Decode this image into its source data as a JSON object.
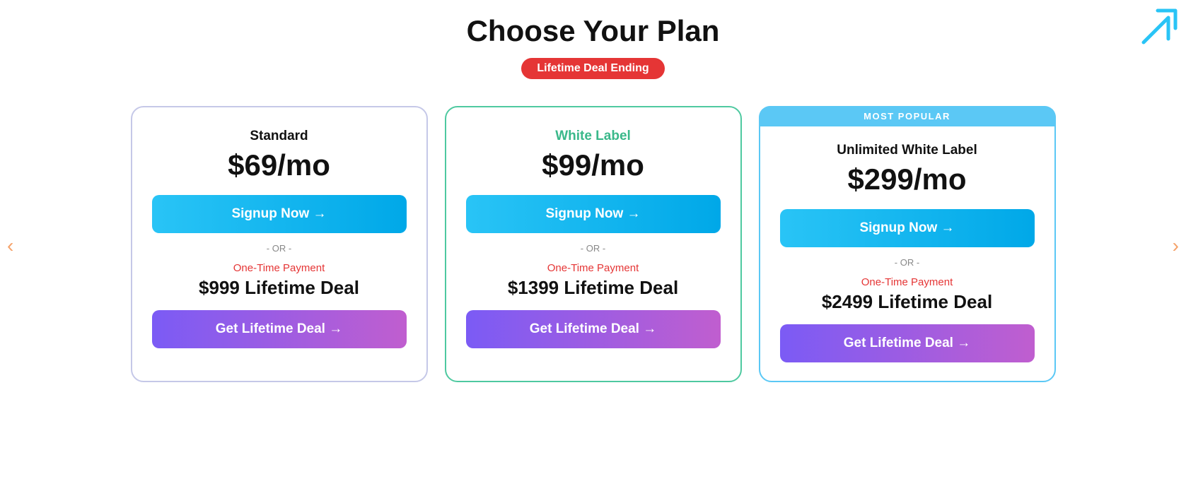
{
  "page": {
    "title": "Choose Your Plan",
    "badge": "Lifetime Deal Ending"
  },
  "nav": {
    "left_arrow": "‹",
    "right_arrow": "›"
  },
  "plans": [
    {
      "id": "standard",
      "name": "Standard",
      "name_color": "default",
      "price": "$69/mo",
      "most_popular": false,
      "signup_label": "Signup Now →",
      "or_text": "- OR -",
      "one_time_label": "One-Time Payment",
      "lifetime_price": "$999 Lifetime Deal",
      "lifetime_label": "Get Lifetime Deal →"
    },
    {
      "id": "white-label",
      "name": "White Label",
      "name_color": "green",
      "price": "$99/mo",
      "most_popular": false,
      "signup_label": "Signup Now →",
      "or_text": "- OR -",
      "one_time_label": "One-Time Payment",
      "lifetime_price": "$1399 Lifetime Deal",
      "lifetime_label": "Get Lifetime Deal →"
    },
    {
      "id": "unlimited",
      "name": "Unlimited White Label",
      "name_color": "default",
      "price": "$299/mo",
      "most_popular": true,
      "most_popular_label": "MOST POPULAR",
      "signup_label": "Signup Now →",
      "or_text": "- OR -",
      "one_time_label": "One-Time Payment",
      "lifetime_price": "$2499 Lifetime Deal",
      "lifetime_label": "Get Lifetime Deal →"
    }
  ]
}
